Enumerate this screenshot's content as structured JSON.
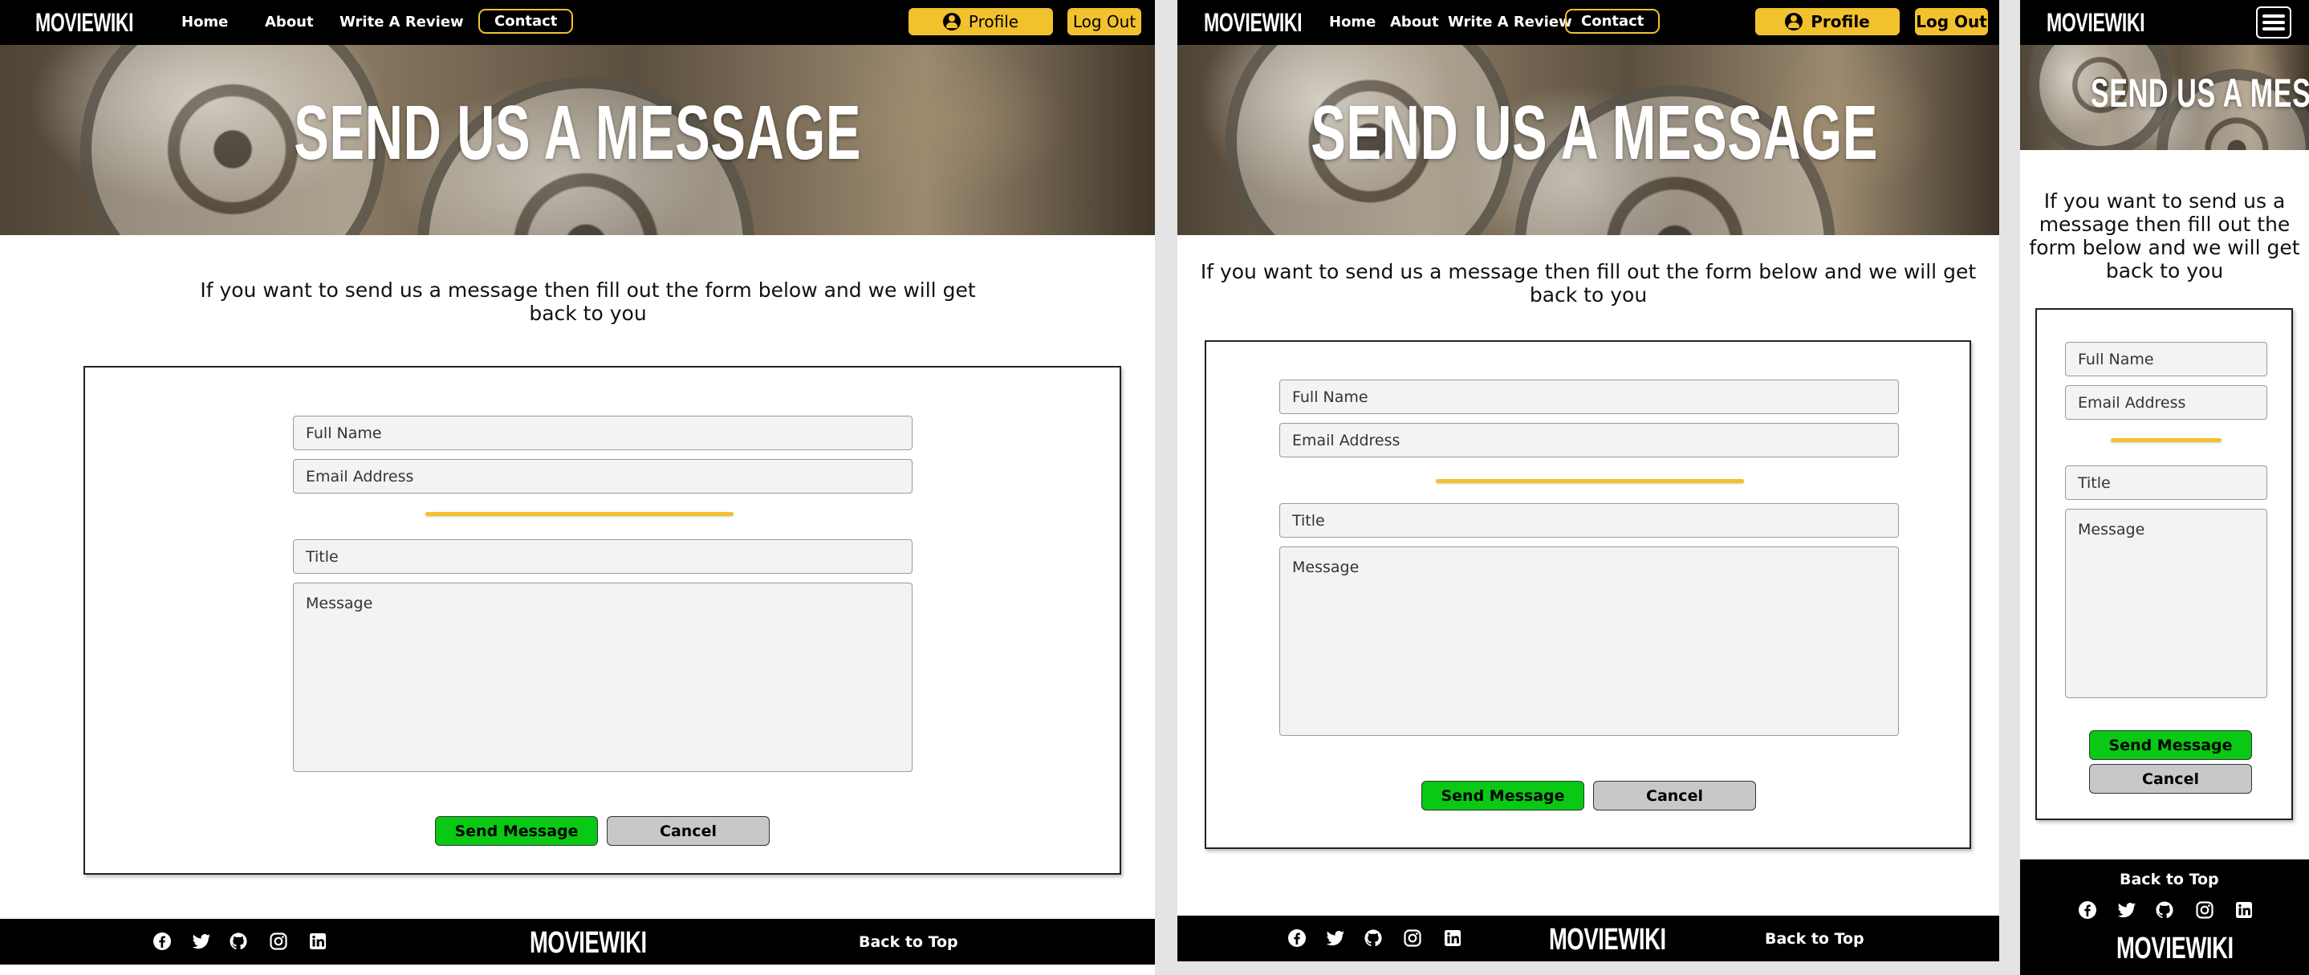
{
  "brand": "MOVIEWIKI",
  "nav": {
    "home": "Home",
    "about": "About",
    "review": "Write A Review",
    "contact": "Contact",
    "profile": "Profile",
    "logout": "Log Out"
  },
  "hero": {
    "title": "SEND US A MESSAGE"
  },
  "intro": {
    "line1": "If you want to send us a message then fill out the form below and we will get",
    "line2": "back to you",
    "narrow_lines": [
      "If you want to send us a",
      "message then fill out the",
      "form below and we will get",
      "back to you"
    ]
  },
  "form": {
    "name_placeholder": "Full Name",
    "email_placeholder": "Email Address",
    "title_placeholder": "Title",
    "message_placeholder": "Message",
    "send_label": "Send Message",
    "cancel_label": "Cancel"
  },
  "footer": {
    "back_to_top": "Back to Top",
    "social_icons": [
      "facebook-icon",
      "twitter-icon",
      "github-icon",
      "instagram-icon",
      "linkedin-icon"
    ]
  },
  "colors": {
    "accent": "#f2c12e",
    "send": "#09c914",
    "cancel": "#c8c8c8",
    "nav_bg": "#000000"
  }
}
